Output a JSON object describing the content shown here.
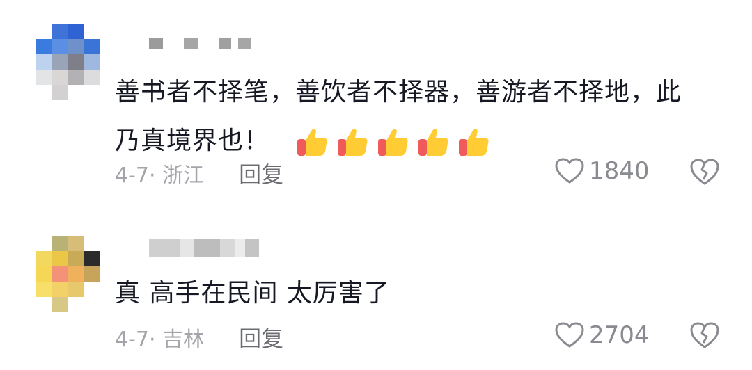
{
  "comments": [
    {
      "line1": "善书者不择笔，善饮者不择器，善游者不择地，此",
      "line2": "乃真境界也！",
      "reaction_icons": [
        "thumbs-up-icon",
        "thumbs-up-icon",
        "thumbs-up-icon",
        "thumbs-up-icon",
        "thumbs-up-icon"
      ],
      "date_location": "4-7· 浙江",
      "reply_label": "回复",
      "like_count": "1840"
    },
    {
      "line1": "真 高手在民间 太厉害了",
      "date_location": "4-7· 吉林",
      "reply_label": "回复",
      "like_count": "2704"
    }
  ],
  "colors": {
    "meta_text": "#a4a5aa",
    "body_text": "#161823",
    "icon_stroke": "#8a8b91"
  }
}
